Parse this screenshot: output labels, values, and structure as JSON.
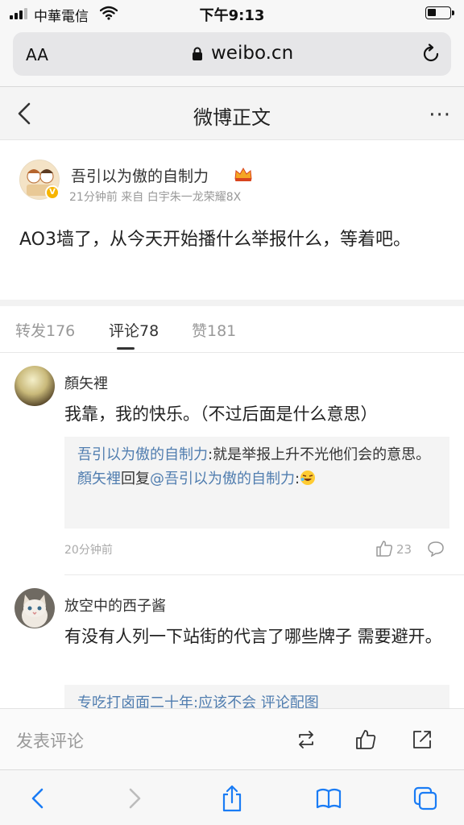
{
  "status_bar": {
    "carrier": "中華電信",
    "time": "下午9:13"
  },
  "browser": {
    "text_size_label": "AA",
    "domain": "weibo.cn"
  },
  "nav": {
    "title": "微博正文",
    "more_label": "···"
  },
  "post": {
    "author": "吾引以为傲的自制力",
    "meta": "21分钟前  来自  白宇朱一龙荣耀8X",
    "content": "AO3墙了，从今天开始播什么举报什么，等着吧。"
  },
  "tabs": [
    {
      "label": "转发176",
      "active": false
    },
    {
      "label": "评论78",
      "active": true
    },
    {
      "label": "赞181",
      "active": false
    }
  ],
  "comments": [
    {
      "name": "顏矢裡",
      "text": "我靠，我的快乐。（不过后面是什么意思）",
      "reply1_author": "吾引以为傲的自制力",
      "reply1_text": ":就是举报上升不光他们会的意思。",
      "reply2_author": "顏矢裡",
      "reply2_mid": "回复",
      "reply2_target": "@吾引以为傲的自制力",
      "reply2_text": ":",
      "time": "20分钟前",
      "likes": "23"
    },
    {
      "name": "放空中的西子酱",
      "text": "有没有人列一下站街的代言了哪些牌子 需要避开。",
      "reply_partial": "专吃打卤面二十年:应该不会 评论配图"
    }
  ],
  "input_bar": {
    "placeholder": "发表评论"
  },
  "colors": {
    "link_blue": "#507daf",
    "toolbar_blue": "#1a7cf5",
    "badge_gold": "#f7b500"
  }
}
